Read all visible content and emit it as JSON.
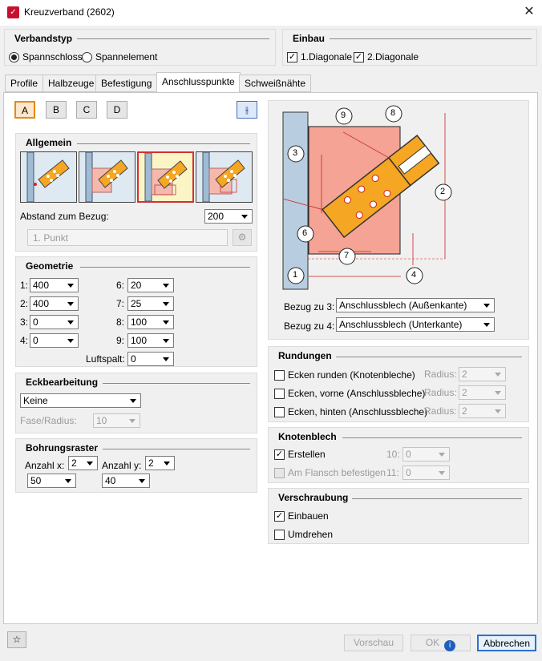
{
  "window": {
    "title": "Kreuzverband (2602)"
  },
  "verbandstyp": {
    "title": "Verbandstyp",
    "opt1": "Spannschloss",
    "opt2": "Spannelement"
  },
  "einbau": {
    "title": "Einbau",
    "diag1": "1.Diagonale",
    "diag2": "2.Diagonale"
  },
  "tabs": [
    "Profile",
    "Halbzeuge",
    "Befestigung",
    "Anschlusspunkte",
    "Schweißnähte"
  ],
  "point_buttons": [
    "A",
    "B",
    "C",
    "D"
  ],
  "allgemein": {
    "title": "Allgemein",
    "abstand_label": "Abstand zum Bezug:",
    "abstand_value": "200",
    "punkt_placeholder": "1. Punkt"
  },
  "geometrie": {
    "title": "Geometrie",
    "fields": [
      {
        "label": "1:",
        "value": "400"
      },
      {
        "label": "2:",
        "value": "400"
      },
      {
        "label": "3:",
        "value": "0"
      },
      {
        "label": "4:",
        "value": "0"
      },
      {
        "label": "6:",
        "value": "20"
      },
      {
        "label": "7:",
        "value": "25"
      },
      {
        "label": "8:",
        "value": "100"
      },
      {
        "label": "9:",
        "value": "100"
      }
    ],
    "luftspalt_label": "Luftspalt:",
    "luftspalt_value": "0"
  },
  "eck": {
    "title": "Eckbearbeitung",
    "value": "Keine",
    "fase_label": "Fase/Radius:",
    "fase_value": "10"
  },
  "bohr": {
    "title": "Bohrungsraster",
    "ax_label": "Anzahl x:",
    "ax_value": "2",
    "ay_label": "Anzahl y:",
    "ay_value": "2",
    "dx_value": "50",
    "dy_value": "40"
  },
  "diagram": {
    "labels": [
      "1",
      "2",
      "3",
      "4",
      "6",
      "7",
      "8",
      "9"
    ],
    "bezug3_label": "Bezug zu 3:",
    "bezug3_value": "Anschlussblech (Außenkante)",
    "bezug4_label": "Bezug zu 4:",
    "bezug4_value": "Anschlussblech (Unterkante)"
  },
  "rundungen": {
    "title": "Rundungen",
    "r1": "Ecken runden (Knotenbleche)",
    "r2": "Ecken, vorne (Anschlussbleche)",
    "r3": "Ecken, hinten (Anschlussbleche)",
    "radius_label": "Radius:",
    "radius_value": "2"
  },
  "knoten": {
    "title": "Knotenblech",
    "erstellen": "Erstellen",
    "flansch": "Am Flansch befestigen",
    "l10": "10:",
    "v10": "0",
    "l11": "11:",
    "v11": "0"
  },
  "verschr": {
    "title": "Verschraubung",
    "einbauen": "Einbauen",
    "umdrehen": "Umdrehen"
  },
  "footer": {
    "vorschau": "Vorschau",
    "ok": "OK",
    "abbrechen": "Abbrechen"
  },
  "colors": {
    "accent_orange": "#f5a623",
    "plate_red": "#f4a394",
    "column_blue": "#b8cde0",
    "selection": "#d43030"
  }
}
